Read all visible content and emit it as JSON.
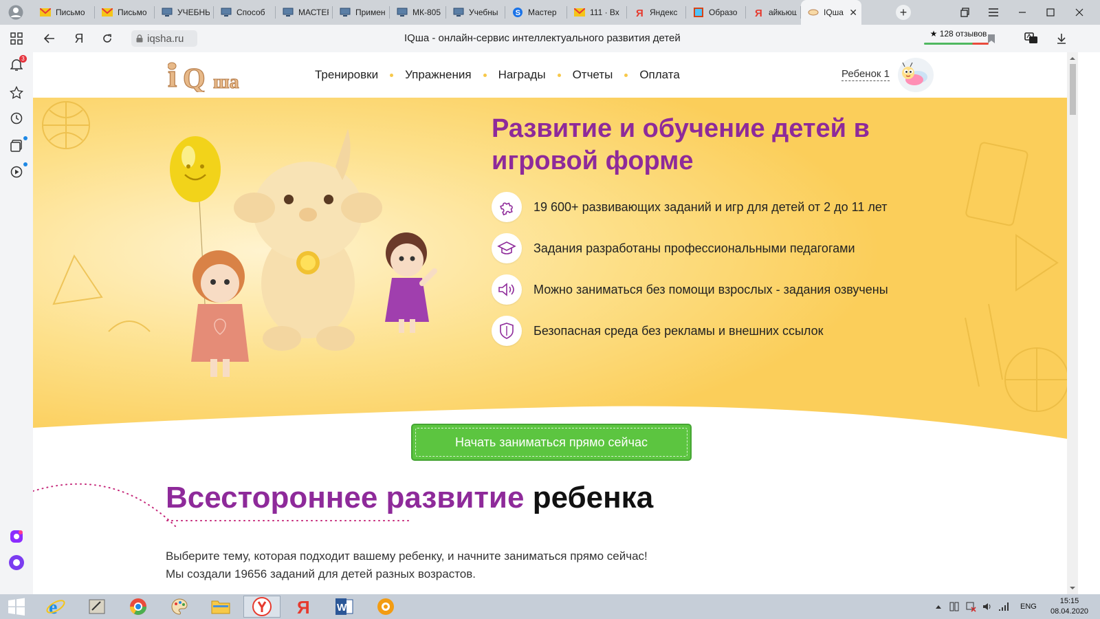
{
  "browser": {
    "tabs": [
      {
        "label": "Письмо",
        "icon": "mail-icon"
      },
      {
        "label": "Письмо",
        "icon": "mail-icon"
      },
      {
        "label": "УЧЕБНЫ",
        "icon": "monitor-icon"
      },
      {
        "label": "Способ",
        "icon": "monitor-icon"
      },
      {
        "label": "МАСТЕР",
        "icon": "monitor-icon"
      },
      {
        "label": "Примен",
        "icon": "monitor-icon"
      },
      {
        "label": "МК-805",
        "icon": "monitor-icon"
      },
      {
        "label": "Учебны",
        "icon": "monitor-icon"
      },
      {
        "label": "Мастер",
        "icon": "skype-icon"
      },
      {
        "label": "111 · Вх",
        "icon": "mail-icon"
      },
      {
        "label": "Яндекс",
        "icon": "yandex-icon"
      },
      {
        "label": "Образо",
        "icon": "image-icon"
      },
      {
        "label": "айкьюш",
        "icon": "yandex-icon"
      },
      {
        "label": "IQша",
        "icon": "iqsha-icon",
        "active": true
      }
    ],
    "url": "iqsha.ru",
    "page_title": "IQша - онлайн-сервис интеллектуального развития детей",
    "reviews": "★ 128 отзывов",
    "yandex_nav": "Я",
    "notifications_badge": "3"
  },
  "site": {
    "nav": [
      "Тренировки",
      "Упражнения",
      "Награды",
      "Отчеты",
      "Оплата"
    ],
    "child": "Ребенок 1",
    "hero_title": "Развитие и обучение детей в игровой форме",
    "features": [
      {
        "text": "19 600+ развивающих заданий и игр для детей от 2 до 11 лет",
        "icon": "puzzle-icon"
      },
      {
        "text": "Задания разработаны профессиональными педагогами",
        "icon": "graduation-cap-icon"
      },
      {
        "text": "Можно заниматься без помощи взрослых - задания озвучены",
        "icon": "speaker-icon"
      },
      {
        "text": "Безопасная среда без рекламы и внешних ссылок",
        "icon": "shield-icon"
      }
    ],
    "cta": "Начать заниматься прямо сейчас",
    "section_title_1": "Всестороннее развитие",
    "section_title_2": "ребенка",
    "section_desc_1": "Выберите тему, которая подходит вашему ребенку, и начните заниматься прямо сейчас!",
    "section_desc_2": "Мы создали 19656 заданий для детей разных возрастов."
  },
  "taskbar": {
    "lang": "ENG",
    "time": "15:15",
    "date": "08.04.2020"
  },
  "colors": {
    "brand_purple": "#8e2a9a",
    "hero_yellow": "#fcd466",
    "cta_green": "#5cc540"
  }
}
